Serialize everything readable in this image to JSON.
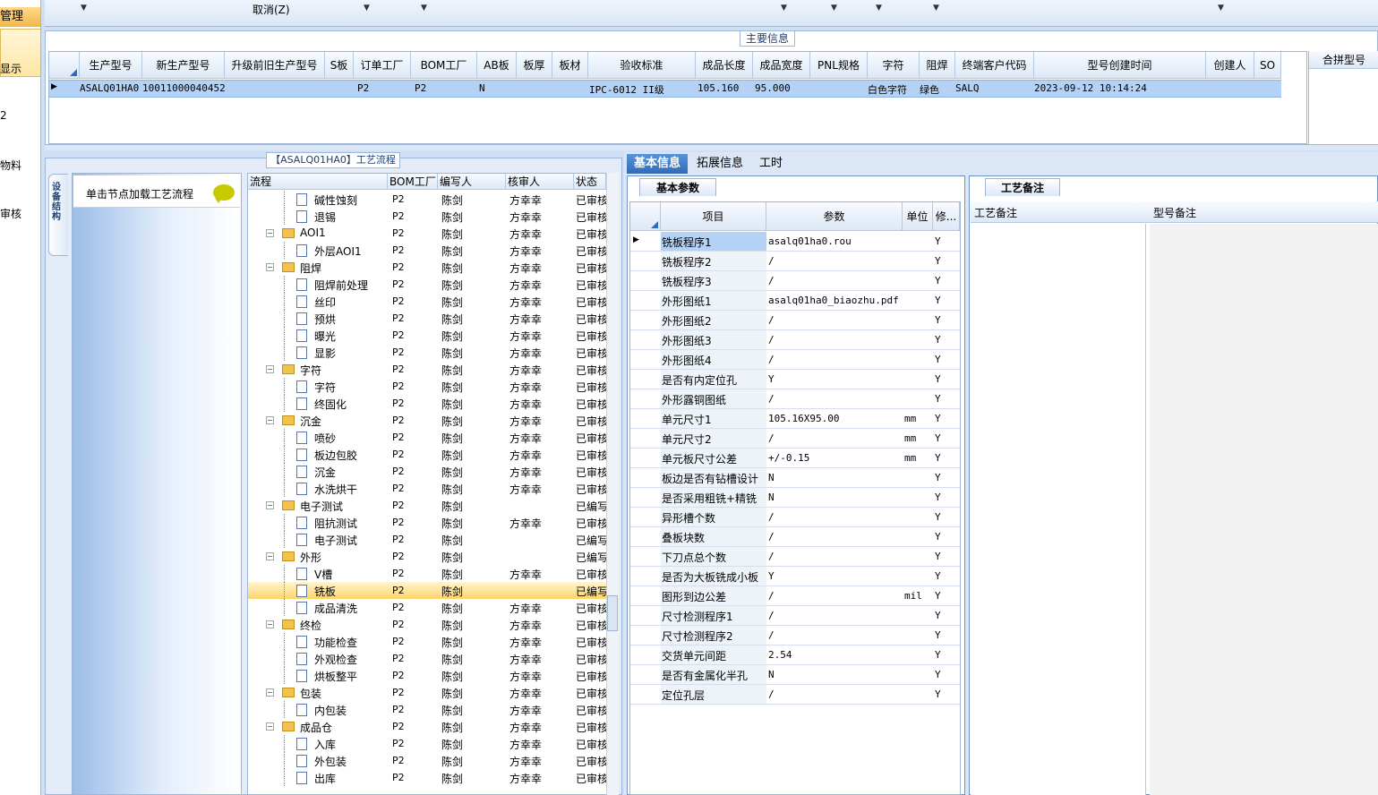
{
  "left_nav": {
    "header": "管理",
    "items": [
      "显示",
      "",
      "2",
      "",
      "物料",
      "",
      "审核"
    ]
  },
  "toolbar": {
    "cancel_label": "取消(Z)"
  },
  "main_info": {
    "legend": "主要信息",
    "columns": [
      "生产型号",
      "新生产型号",
      "升级前旧生产型号",
      "S板",
      "订单工厂",
      "BOM工厂",
      "AB板",
      "板厚",
      "板材",
      "验收标准",
      "成品长度",
      "成品宽度",
      "PNL规格",
      "字符",
      "阻焊",
      "终端客户代码",
      "型号创建时间",
      "创建人",
      "SO"
    ],
    "row": {
      "c0": "ASALQ01HA0",
      "c1": "10011000040452",
      "c2": "",
      "c3": "",
      "c4": "P2",
      "c5": "P2",
      "c6": "N",
      "c7": "",
      "c8": "",
      "c9": "IPC-6012 II级",
      "c10": "105.160",
      "c11": "95.000",
      "c12": "",
      "c13": "白色字符",
      "c14": "绿色",
      "c15": "SALQ",
      "c16": "2023-09-12 10:14:24",
      "c17": "",
      "c18": ""
    },
    "merge_header": "合拼型号"
  },
  "flow": {
    "title": "【ASALQ01HA0】工艺流程",
    "vtab_label": "设备结构",
    "hint": "单击节点加载工艺流程",
    "columns": [
      "流程",
      "BOM工厂",
      "编写人",
      "核审人",
      "状态"
    ],
    "rows": [
      {
        "name": "碱性蚀刻",
        "level": 2,
        "factory": "P2",
        "writer": "陈剑",
        "reviewer": "方幸幸",
        "status": "已审核"
      },
      {
        "name": "退锡",
        "level": 2,
        "factory": "P2",
        "writer": "陈剑",
        "reviewer": "方幸幸",
        "status": "已审核"
      },
      {
        "name": "AOI1",
        "level": 1,
        "factory": "P2",
        "writer": "陈剑",
        "reviewer": "方幸幸",
        "status": "已审核"
      },
      {
        "name": "外层AOI1",
        "level": 2,
        "factory": "P2",
        "writer": "陈剑",
        "reviewer": "方幸幸",
        "status": "已审核"
      },
      {
        "name": "阻焊",
        "level": 1,
        "factory": "P2",
        "writer": "陈剑",
        "reviewer": "方幸幸",
        "status": "已审核"
      },
      {
        "name": "阻焊前处理",
        "level": 2,
        "factory": "P2",
        "writer": "陈剑",
        "reviewer": "方幸幸",
        "status": "已审核"
      },
      {
        "name": "丝印",
        "level": 2,
        "factory": "P2",
        "writer": "陈剑",
        "reviewer": "方幸幸",
        "status": "已审核"
      },
      {
        "name": "预烘",
        "level": 2,
        "factory": "P2",
        "writer": "陈剑",
        "reviewer": "方幸幸",
        "status": "已审核"
      },
      {
        "name": "曝光",
        "level": 2,
        "factory": "P2",
        "writer": "陈剑",
        "reviewer": "方幸幸",
        "status": "已审核"
      },
      {
        "name": "显影",
        "level": 2,
        "factory": "P2",
        "writer": "陈剑",
        "reviewer": "方幸幸",
        "status": "已审核"
      },
      {
        "name": "字符",
        "level": 1,
        "factory": "P2",
        "writer": "陈剑",
        "reviewer": "方幸幸",
        "status": "已审核"
      },
      {
        "name": "字符",
        "level": 2,
        "factory": "P2",
        "writer": "陈剑",
        "reviewer": "方幸幸",
        "status": "已审核"
      },
      {
        "name": "终固化",
        "level": 2,
        "factory": "P2",
        "writer": "陈剑",
        "reviewer": "方幸幸",
        "status": "已审核"
      },
      {
        "name": "沉金",
        "level": 1,
        "factory": "P2",
        "writer": "陈剑",
        "reviewer": "方幸幸",
        "status": "已审核"
      },
      {
        "name": "喷砂",
        "level": 2,
        "factory": "P2",
        "writer": "陈剑",
        "reviewer": "方幸幸",
        "status": "已审核"
      },
      {
        "name": "板边包胶",
        "level": 2,
        "factory": "P2",
        "writer": "陈剑",
        "reviewer": "方幸幸",
        "status": "已审核"
      },
      {
        "name": "沉金",
        "level": 2,
        "factory": "P2",
        "writer": "陈剑",
        "reviewer": "方幸幸",
        "status": "已审核"
      },
      {
        "name": "水洗烘干",
        "level": 2,
        "factory": "P2",
        "writer": "陈剑",
        "reviewer": "方幸幸",
        "status": "已审核"
      },
      {
        "name": "电子测试",
        "level": 1,
        "factory": "P2",
        "writer": "陈剑",
        "reviewer": "",
        "status": "已编写"
      },
      {
        "name": "阻抗测试",
        "level": 2,
        "factory": "P2",
        "writer": "陈剑",
        "reviewer": "方幸幸",
        "status": "已审核"
      },
      {
        "name": "电子测试",
        "level": 2,
        "factory": "P2",
        "writer": "陈剑",
        "reviewer": "",
        "status": "已编写"
      },
      {
        "name": "外形",
        "level": 1,
        "factory": "P2",
        "writer": "陈剑",
        "reviewer": "",
        "status": "已编写"
      },
      {
        "name": "V槽",
        "level": 2,
        "factory": "P2",
        "writer": "陈剑",
        "reviewer": "方幸幸",
        "status": "已审核"
      },
      {
        "name": "铣板",
        "level": 2,
        "factory": "P2",
        "writer": "陈剑",
        "reviewer": "",
        "status": "已编写",
        "selected": true
      },
      {
        "name": "成品清洗",
        "level": 2,
        "factory": "P2",
        "writer": "陈剑",
        "reviewer": "方幸幸",
        "status": "已审核"
      },
      {
        "name": "终检",
        "level": 1,
        "factory": "P2",
        "writer": "陈剑",
        "reviewer": "方幸幸",
        "status": "已审核"
      },
      {
        "name": "功能检查",
        "level": 2,
        "factory": "P2",
        "writer": "陈剑",
        "reviewer": "方幸幸",
        "status": "已审核"
      },
      {
        "name": "外观检查",
        "level": 2,
        "factory": "P2",
        "writer": "陈剑",
        "reviewer": "方幸幸",
        "status": "已审核"
      },
      {
        "name": "烘板整平",
        "level": 2,
        "factory": "P2",
        "writer": "陈剑",
        "reviewer": "方幸幸",
        "status": "已审核"
      },
      {
        "name": "包装",
        "level": 1,
        "factory": "P2",
        "writer": "陈剑",
        "reviewer": "方幸幸",
        "status": "已审核"
      },
      {
        "name": "内包装",
        "level": 2,
        "factory": "P2",
        "writer": "陈剑",
        "reviewer": "方幸幸",
        "status": "已审核"
      },
      {
        "name": "成品仓",
        "level": 1,
        "factory": "P2",
        "writer": "陈剑",
        "reviewer": "方幸幸",
        "status": "已审核"
      },
      {
        "name": "入库",
        "level": 2,
        "factory": "P2",
        "writer": "陈剑",
        "reviewer": "方幸幸",
        "status": "已审核"
      },
      {
        "name": "外包装",
        "level": 2,
        "factory": "P2",
        "writer": "陈剑",
        "reviewer": "方幸幸",
        "status": "已审核"
      },
      {
        "name": "出库",
        "level": 2,
        "factory": "P2",
        "writer": "陈剑",
        "reviewer": "方幸幸",
        "status": "已审核"
      }
    ]
  },
  "tabs": [
    "基本信息",
    "拓展信息",
    "工时"
  ],
  "basic": {
    "tab": "基本参数",
    "columns": [
      "项目",
      "参数",
      "单位",
      "修..."
    ],
    "rows": [
      {
        "item": "铣板程序1",
        "param": "asalq01ha0.rou",
        "unit": "",
        "mod": "Y"
      },
      {
        "item": "铣板程序2",
        "param": "/",
        "unit": "",
        "mod": "Y"
      },
      {
        "item": "铣板程序3",
        "param": "/",
        "unit": "",
        "mod": "Y"
      },
      {
        "item": "外形图纸1",
        "param": "asalq01ha0_biaozhu.pdf",
        "unit": "",
        "mod": "Y"
      },
      {
        "item": "外形图纸2",
        "param": "/",
        "unit": "",
        "mod": "Y"
      },
      {
        "item": "外形图纸3",
        "param": "/",
        "unit": "",
        "mod": "Y"
      },
      {
        "item": "外形图纸4",
        "param": "/",
        "unit": "",
        "mod": "Y"
      },
      {
        "item": "是否有内定位孔",
        "param": "Y",
        "unit": "",
        "mod": "Y"
      },
      {
        "item": "外形露铜图纸",
        "param": "/",
        "unit": "",
        "mod": "Y"
      },
      {
        "item": "单元尺寸1",
        "param": "105.16X95.00",
        "unit": "mm",
        "mod": "Y"
      },
      {
        "item": "单元尺寸2",
        "param": "/",
        "unit": "mm",
        "mod": "Y"
      },
      {
        "item": "单元板尺寸公差",
        "param": "+/-0.15",
        "unit": "mm",
        "mod": "Y"
      },
      {
        "item": "板边是否有钻槽设计",
        "param": "N",
        "unit": "",
        "mod": "Y"
      },
      {
        "item": "是否采用粗铣+精铣",
        "param": "N",
        "unit": "",
        "mod": "Y"
      },
      {
        "item": "异形槽个数",
        "param": "/",
        "unit": "",
        "mod": "Y"
      },
      {
        "item": "叠板块数",
        "param": "/",
        "unit": "",
        "mod": "Y"
      },
      {
        "item": "下刀点总个数",
        "param": "/",
        "unit": "",
        "mod": "Y"
      },
      {
        "item": "是否为大板铣成小板",
        "param": "Y",
        "unit": "",
        "mod": "Y"
      },
      {
        "item": "图形到边公差",
        "param": "/",
        "unit": "mil",
        "mod": "Y"
      },
      {
        "item": "尺寸检测程序1",
        "param": "/",
        "unit": "",
        "mod": "Y"
      },
      {
        "item": "尺寸检测程序2",
        "param": "/",
        "unit": "",
        "mod": "Y"
      },
      {
        "item": "交货单元间距",
        "param": "2.54",
        "unit": "",
        "mod": "Y"
      },
      {
        "item": "是否有金属化半孔",
        "param": "N",
        "unit": "",
        "mod": "Y"
      },
      {
        "item": "定位孔层",
        "param": "/",
        "unit": "",
        "mod": "Y"
      }
    ]
  },
  "notes": {
    "tab": "工艺备注",
    "col1": "工艺备注",
    "col2": "型号备注"
  },
  "colors": {
    "accent": "#2f6bb8",
    "selection": "#b4d2f6",
    "tree_selected": "#ffd46b"
  }
}
